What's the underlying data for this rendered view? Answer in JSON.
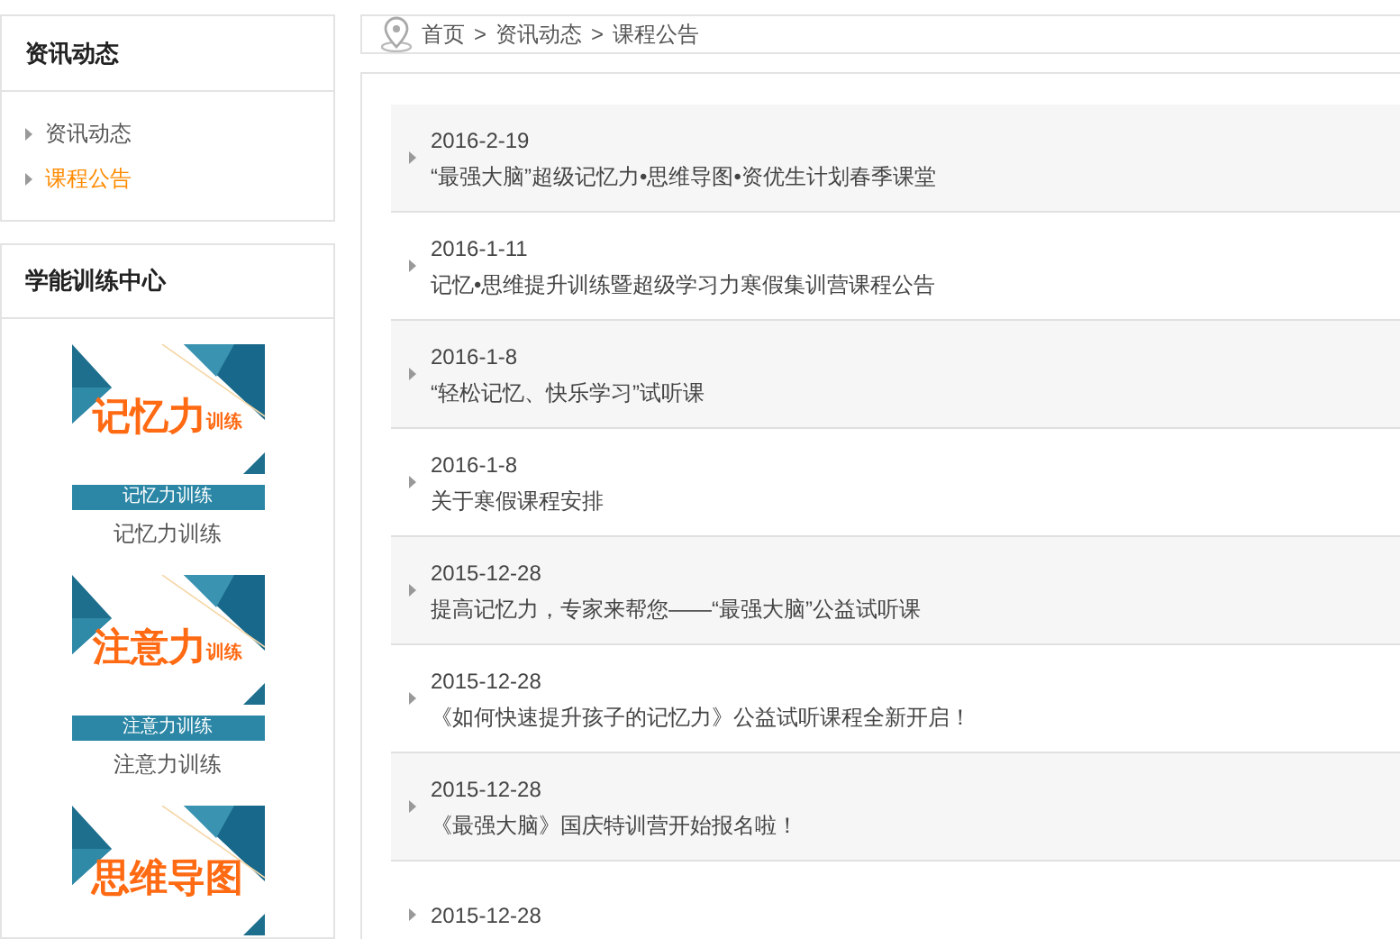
{
  "sidebar": {
    "news_box": {
      "title": "资讯动态",
      "items": [
        {
          "label": "资讯动态",
          "selected": false
        },
        {
          "label": "课程公告",
          "selected": true
        }
      ]
    },
    "training_box": {
      "title": "学能训练中心",
      "cards": [
        {
          "banner_title": "记忆力",
          "banner_suffix": "训练",
          "caption_bar": "记忆力训练",
          "caption": "记忆力训练"
        },
        {
          "banner_title": "注意力",
          "banner_suffix": "训练",
          "caption_bar": "注意力训练",
          "caption": "注意力训练"
        },
        {
          "banner_title": "思维导图"
        }
      ]
    }
  },
  "breadcrumb": [
    "首页",
    "资讯动态",
    "课程公告"
  ],
  "breadcrumb_separator": ">",
  "notices": [
    {
      "date": "2016-2-19",
      "title": "“最强大脑”超级记忆力•思维导图•资优生计划春季课堂"
    },
    {
      "date": "2016-1-11",
      "title": "记忆•思维提升训练暨超级学习力寒假集训营课程公告"
    },
    {
      "date": "2016-1-8",
      "title": "“轻松记忆、快乐学习”试听课"
    },
    {
      "date": "2016-1-8",
      "title": "关于寒假课程安排"
    },
    {
      "date": "2015-12-28",
      "title": "提高记忆力，专家来帮您——“最强大脑”公益试听课"
    },
    {
      "date": "2015-12-28",
      "title": "《如何快速提升孩子的记忆力》公益试听课程全新开启！"
    },
    {
      "date": "2015-12-28",
      "title": "《最强大脑》国庆特训营开始报名啦！"
    },
    {
      "date": "2015-12-28"
    }
  ]
}
